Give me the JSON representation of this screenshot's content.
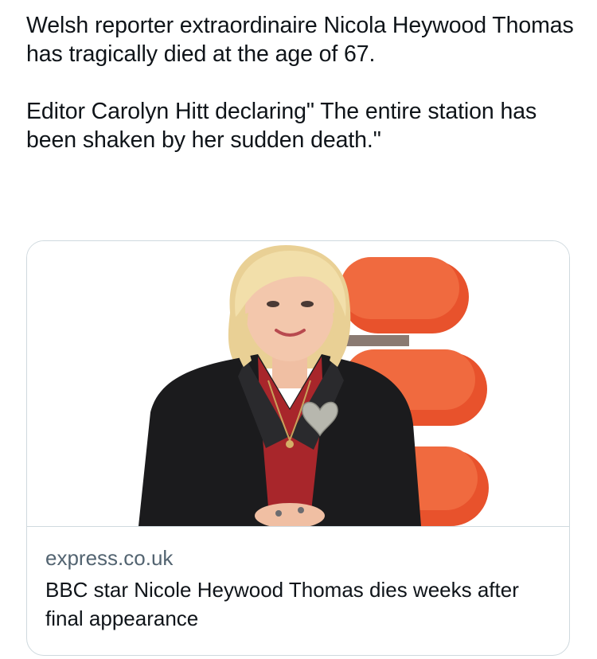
{
  "tweet": {
    "paragraphs": [
      "Welsh reporter extraordinaire Nicola Heywood Thomas has tragically died at the age of 67.",
      "Editor Carolyn Hitt declaring\" The entire station has been shaken by her sudden death.\""
    ]
  },
  "card": {
    "image_alt": "Portrait photo of a woman with blonde hair in a black jacket seated in an orange chair",
    "domain": "express.co.uk",
    "title": "BBC star Nicole Heywood Thomas dies weeks after final appearance"
  },
  "colors": {
    "text": "#0f1419",
    "secondary_text": "#536471",
    "border": "#cfd9de",
    "chair": "#e8522c",
    "jacket": "#1b1b1d",
    "blouse": "#a8262b",
    "hair": "#efd9a2"
  }
}
